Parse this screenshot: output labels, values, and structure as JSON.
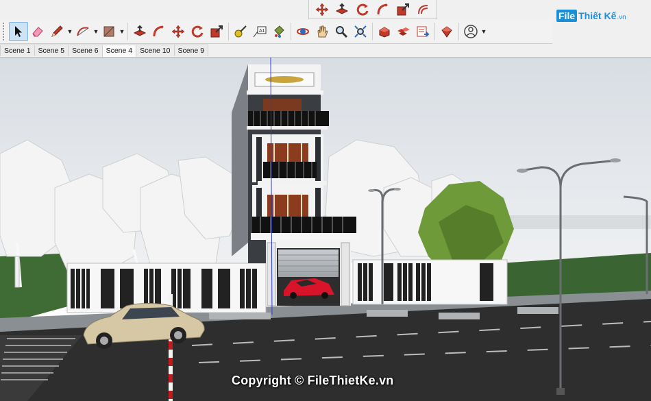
{
  "toolbar": {
    "floating_tools": [
      {
        "name": "move-icon"
      },
      {
        "name": "push-pull-icon"
      },
      {
        "name": "rotate-icon"
      },
      {
        "name": "follow-me-icon"
      },
      {
        "name": "scale-icon"
      },
      {
        "name": "offset-icon"
      }
    ],
    "main_tools": [
      {
        "name": "select-icon",
        "active": true
      },
      {
        "name": "eraser-icon"
      },
      {
        "name": "pencil-line-icon",
        "dropdown": true
      },
      {
        "name": "arc-icon",
        "dropdown": true
      },
      {
        "name": "rectangle-icon",
        "dropdown": true
      },
      {
        "name": "push-pull-icon"
      },
      {
        "name": "follow-me-icon"
      },
      {
        "name": "move-icon"
      },
      {
        "name": "rotate-icon"
      },
      {
        "name": "scale-icon"
      },
      {
        "name": "tape-measure-icon"
      },
      {
        "name": "text-icon"
      },
      {
        "name": "paint-bucket-icon"
      },
      {
        "name": "orbit-icon"
      },
      {
        "name": "pan-icon"
      },
      {
        "name": "zoom-icon"
      },
      {
        "name": "zoom-extents-icon"
      },
      {
        "name": "warehouse-icon"
      },
      {
        "name": "extension-warehouse-icon"
      },
      {
        "name": "layout-send-icon"
      },
      {
        "name": "extension-manager-icon"
      },
      {
        "name": "account-icon",
        "dropdown": true
      }
    ]
  },
  "scenes": [
    {
      "label": "Scene 1",
      "active": false
    },
    {
      "label": "Scene 5",
      "active": false
    },
    {
      "label": "Scene 6",
      "active": false
    },
    {
      "label": "Scene 4",
      "active": true
    },
    {
      "label": "Scene 10",
      "active": false
    },
    {
      "label": "Scene 9",
      "active": false
    }
  ],
  "watermark": {
    "logo_box": "File",
    "logo_text": "Thiết Kế",
    "logo_tld": ".vn",
    "copyright": "Copyright © FileThietKe.vn"
  },
  "colors": {
    "toolbar_bg": "#f2f2f2",
    "active_tool": "#cde4f7",
    "sky": "#e4e8ec",
    "grass": "#3f6b35",
    "road": "#2e2e2e",
    "brand": "#1a8fd6",
    "car_red": "#d8142a"
  }
}
